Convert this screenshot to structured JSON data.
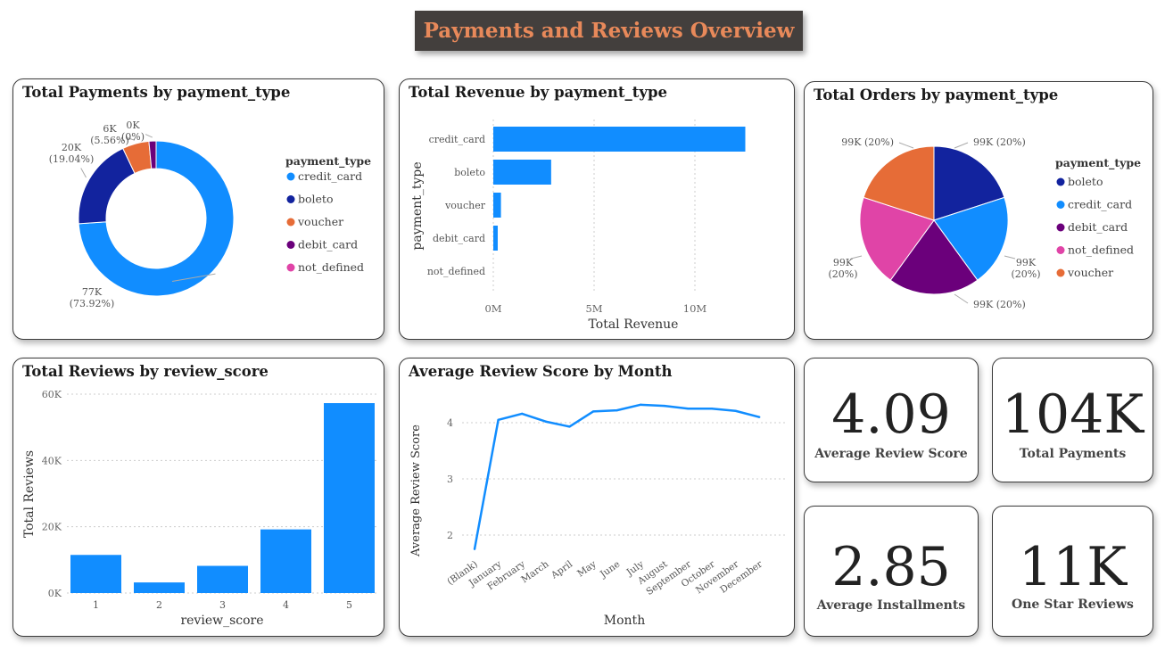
{
  "page_title": "Payments and Reviews Overview",
  "chart_data": [
    {
      "id": "payments_donut",
      "type": "pie",
      "donut": true,
      "title": "Total Payments by payment_type",
      "legend_title": "payment_type",
      "legend_position": "right",
      "slices": [
        {
          "label": "credit_card",
          "value": 77000,
          "display": "77K",
          "pct": "(73.92%)",
          "pct_value": 73.92,
          "color": "#118dff"
        },
        {
          "label": "boleto",
          "value": 20000,
          "display": "20K",
          "pct": "(19.04%)",
          "pct_value": 19.04,
          "color": "#12239e"
        },
        {
          "label": "voucher",
          "value": 6000,
          "display": "6K",
          "pct": "(5.56%)",
          "pct_value": 5.56,
          "color": "#e66c37"
        },
        {
          "label": "debit_card",
          "value": 0,
          "display": "0K",
          "pct": "(0%)",
          "pct_value": 1.48,
          "color": "#6b007b"
        },
        {
          "label": "not_defined",
          "value": 0,
          "display": "",
          "pct": "",
          "pct_value": 0,
          "color": "#e044a7"
        }
      ]
    },
    {
      "id": "revenue_bar",
      "type": "bar",
      "orientation": "horizontal",
      "title": "Total Revenue by payment_type",
      "xlabel": "Total Revenue",
      "ylabel": "payment_type",
      "categories": [
        "credit_card",
        "boleto",
        "voucher",
        "debit_card",
        "not_defined"
      ],
      "values": [
        12.5,
        2.87,
        0.38,
        0.22,
        0.0
      ],
      "xlim": [
        0,
        14
      ],
      "xticks": [
        {
          "v": 0,
          "label": "0M"
        },
        {
          "v": 5,
          "label": "5M"
        },
        {
          "v": 10,
          "label": "10M"
        }
      ],
      "color": "#118dff"
    },
    {
      "id": "orders_pie",
      "type": "pie",
      "title": "Total Orders by payment_type",
      "legend_title": "payment_type",
      "legend_position": "right",
      "slices": [
        {
          "label": "boleto",
          "value": 99000,
          "display": "99K (20%)",
          "color": "#12239e"
        },
        {
          "label": "credit_card",
          "value": 99000,
          "display": "99K\n(20%)",
          "color": "#118dff"
        },
        {
          "label": "debit_card",
          "value": 99000,
          "display": "99K (20%)",
          "color": "#6b007b"
        },
        {
          "label": "not_defined",
          "value": 99000,
          "display": "99K\n(20%)",
          "color": "#e044a7"
        },
        {
          "label": "voucher",
          "value": 99000,
          "display": "99K (20%)",
          "color": "#e66c37"
        }
      ]
    },
    {
      "id": "reviews_bar",
      "type": "bar",
      "title": "Total Reviews by review_score",
      "xlabel": "review_score",
      "ylabel": "Total Reviews",
      "categories": [
        "1",
        "2",
        "3",
        "4",
        "5"
      ],
      "values": [
        11500,
        3200,
        8200,
        19200,
        57300
      ],
      "ylim": [
        0,
        60000
      ],
      "yticks": [
        {
          "v": 0,
          "label": "0K"
        },
        {
          "v": 20000,
          "label": "20K"
        },
        {
          "v": 40000,
          "label": "40K"
        },
        {
          "v": 60000,
          "label": "60K"
        }
      ],
      "color": "#118dff"
    },
    {
      "id": "review_line",
      "type": "line",
      "title": "Average Review Score by Month",
      "xlabel": "Month",
      "ylabel": "Average Review Score",
      "categories": [
        "(Blank)",
        "January",
        "February",
        "March",
        "April",
        "May",
        "June",
        "July",
        "August",
        "September",
        "October",
        "November",
        "December"
      ],
      "values": [
        1.75,
        4.05,
        4.16,
        4.02,
        3.93,
        4.2,
        4.22,
        4.32,
        4.3,
        4.25,
        4.25,
        4.21,
        4.1
      ],
      "ylim": [
        1.6,
        4.5
      ],
      "yticks": [
        2,
        3,
        4
      ],
      "color": "#118dff"
    }
  ],
  "kpis": {
    "avg_review": {
      "value": "4.09",
      "label": "Average Review Score"
    },
    "total_payments": {
      "value": "104K",
      "label": "Total Payments"
    },
    "avg_installments": {
      "value": "2.85",
      "label": "Average Installments"
    },
    "one_star": {
      "value": "11K",
      "label": "One Star Reviews"
    }
  }
}
